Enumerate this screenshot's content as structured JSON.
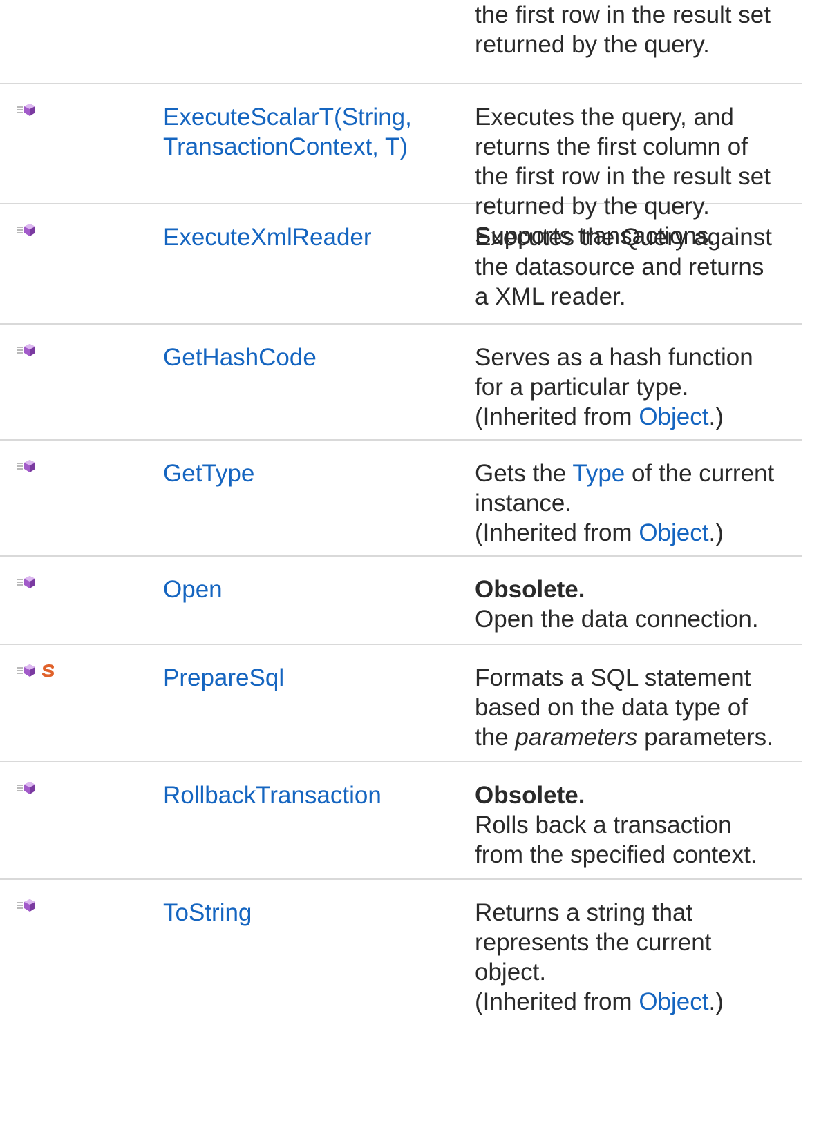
{
  "members": [
    {
      "name": "",
      "desc_lines": [
        "the first row in the result set",
        "returned by the query."
      ]
    },
    {
      "name_lines": [
        "ExecuteScalarT(String,",
        "TransactionContext, T)"
      ],
      "desc_lines": [
        "Executes the query, and",
        "returns the first column of",
        "the first row in the result set",
        "returned by the query.",
        "Supports transactions."
      ],
      "icons": [
        "public-method-icon"
      ]
    },
    {
      "name": "ExecuteXmlReader",
      "desc_lines": [
        "Executes the Query against",
        "the datasource and returns",
        "a XML reader."
      ],
      "icons": [
        "public-method-icon"
      ]
    },
    {
      "name": "GetHashCode",
      "desc_lines": [
        "Serves as a hash function",
        "for a particular type."
      ],
      "inherited": {
        "prefix": "(Inherited from ",
        "link": "Object",
        "suffix": ".)"
      },
      "icons": [
        "public-method-icon"
      ]
    },
    {
      "name": "GetType",
      "desc": {
        "pre": "Gets the ",
        "link": "Type",
        "post": " of the current",
        "line2": "instance."
      },
      "inherited": {
        "prefix": "(Inherited from ",
        "link": "Object",
        "suffix": ".)"
      },
      "icons": [
        "public-method-icon"
      ]
    },
    {
      "name": "Open",
      "obsolete": "Obsolete.",
      "desc_lines": [
        "Open the data connection."
      ],
      "icons": [
        "public-method-icon"
      ]
    },
    {
      "name": "PrepareSql",
      "desc": {
        "line1": "Formats a SQL statement",
        "line2": "based on the data type of",
        "pre3": "the ",
        "ital3": "parameters",
        "post3": " parameters."
      },
      "icons": [
        "public-method-icon",
        "static-icon"
      ]
    },
    {
      "name": "RollbackTransaction",
      "obsolete": "Obsolete.",
      "desc_lines": [
        "Rolls back a transaction",
        "from the specified context."
      ],
      "icons": [
        "public-method-icon"
      ]
    },
    {
      "name": "ToString",
      "desc_lines": [
        "Returns a string that",
        "represents the current",
        "object."
      ],
      "inherited": {
        "prefix": "(Inherited from ",
        "link": "Object",
        "suffix": ".)"
      },
      "icons": [
        "public-method-icon"
      ]
    }
  ],
  "colors": {
    "link": "#1565c0",
    "text": "#2a2a2a",
    "divider": "#d9d9d9",
    "method_icon": "#a25bc9",
    "static_icon": "#e0622b"
  }
}
